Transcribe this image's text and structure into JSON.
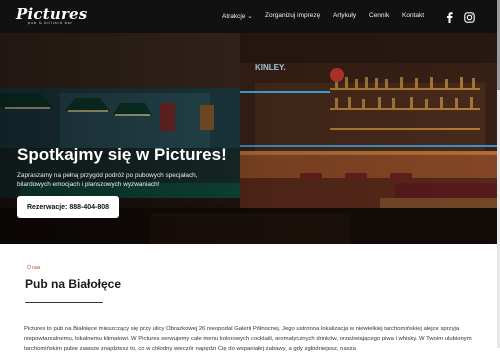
{
  "header": {
    "logo_text": "Pictures",
    "logo_tagline": "pub & billiard bar",
    "nav": [
      {
        "label": "Atrakcje ⌄"
      },
      {
        "label": "Zorganizuj imprezę"
      },
      {
        "label": "Artykuły"
      },
      {
        "label": "Cennik"
      },
      {
        "label": "Kontakt"
      }
    ],
    "social": [
      "facebook-icon",
      "instagram-icon"
    ]
  },
  "hero": {
    "title": "Spotkajmy się w Pictures!",
    "subtitle": "Zapraszamy na pełną przygód podróż po pubowych specjałach, bilardowych emocjach i planszowych wyzwaniach!",
    "cta_label": "Rezerwacje: 888-404-808",
    "neon_sign": "KINLEY."
  },
  "about": {
    "tag": "O nas",
    "title": "Pub na Białołęce",
    "text": "Pictures to pub na Białołęce mieszczący się przy ulicy Obrazkowej 26 nieopodal Galerii Północnej. Jego ustronna lokalizacja w niewielkiej tarchomińskiej alejce sprzyja niepowtarzalnemu, lokalnemu klimatowi. W Pictures serwujemy całe menu kolorowych cocktaili, aromatycznych drinków, orzeźwiającego piwa i whisky. W Twoim ulubionym tarchomińskim pubie zawsze znajdziesz to, co w chłodny wieczór napędzi Cię do wspaniałej zabawy, a gdy zgłodniejesz, nasza"
  },
  "colors": {
    "header_bg": "#111111",
    "accent_red": "#c0392b",
    "neon_blue": "#3fb7ff"
  }
}
